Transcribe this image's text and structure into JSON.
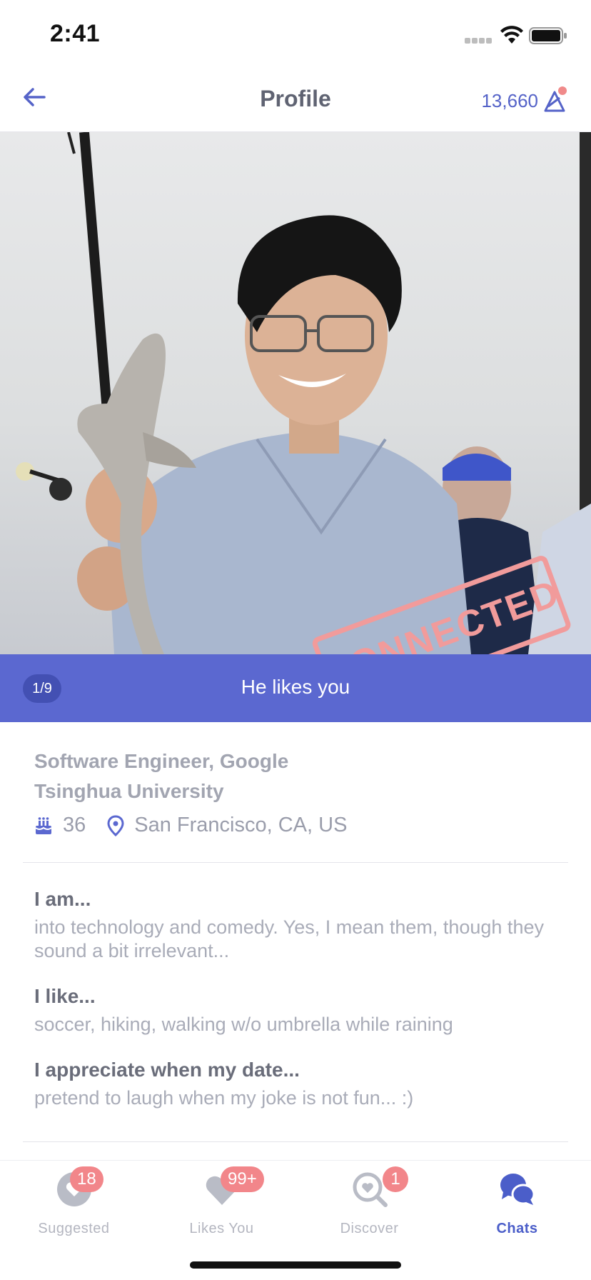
{
  "status_bar": {
    "time": "2:41"
  },
  "header": {
    "title": "Profile",
    "points": "13,660"
  },
  "photo": {
    "stamp": "CONNECTED",
    "counter": "1/9",
    "likes_text": "He likes you"
  },
  "profile": {
    "job": "Software Engineer, Google",
    "school": "Tsinghua University",
    "age": "36",
    "location": "San Francisco, CA, US"
  },
  "sections": [
    {
      "title": "I am...",
      "body": "into technology and comedy. Yes, I mean them, though they sound a bit irrelevant..."
    },
    {
      "title": "I like...",
      "body": "soccer, hiking, walking w/o umbrella while raining"
    },
    {
      "title": "I appreciate when my date...",
      "body": "pretend to laugh when my joke is not fun...   :)"
    }
  ],
  "tabbar": {
    "tabs": [
      {
        "label": "Suggested",
        "badge": "18",
        "icon": "heart-circle-icon"
      },
      {
        "label": "Likes You",
        "badge": "99+",
        "icon": "heart-icon"
      },
      {
        "label": "Discover",
        "badge": "1",
        "icon": "discover-icon"
      },
      {
        "label": "Chats",
        "badge": "",
        "icon": "chat-bubbles-icon"
      }
    ],
    "active": "Chats"
  },
  "colors": {
    "accent": "#5b68d0",
    "badge": "#f2868a",
    "stamp": "#f19b9b"
  }
}
